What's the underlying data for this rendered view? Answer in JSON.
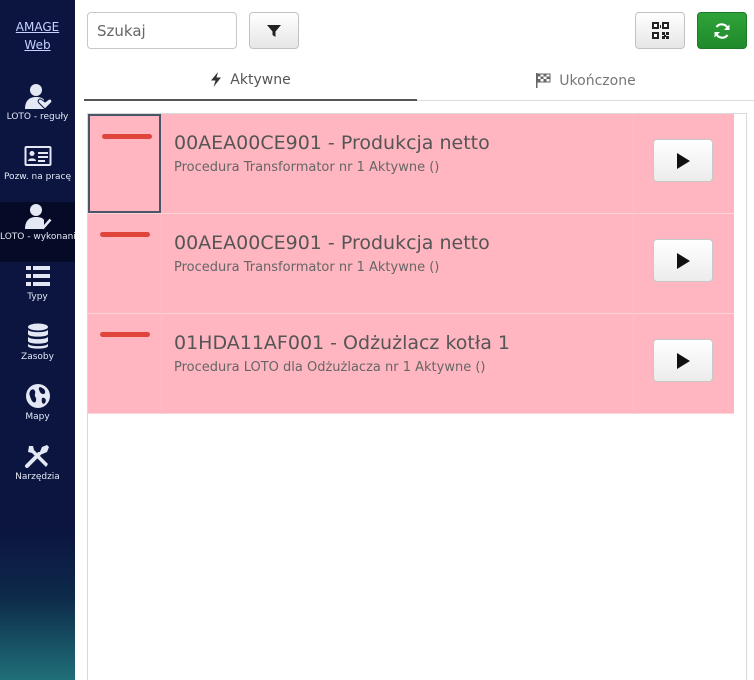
{
  "sidebar": {
    "brand": [
      "AMAGE",
      "Web"
    ],
    "items": [
      {
        "label": "LOTO - reguły",
        "icon": "user-heart-icon",
        "active": false
      },
      {
        "label": "Pozw. na pracę",
        "icon": "id-card-icon",
        "active": false
      },
      {
        "label": "LOTO - wykonanie",
        "icon": "user-check-icon",
        "active": true
      },
      {
        "label": "Typy",
        "icon": "list-icon",
        "active": false
      },
      {
        "label": "Zasoby",
        "icon": "database-icon",
        "active": false
      },
      {
        "label": "Mapy",
        "icon": "globe-icon",
        "active": false
      },
      {
        "label": "Narzędzia",
        "icon": "tools-icon",
        "active": false
      }
    ]
  },
  "toolbar": {
    "search_placeholder": "Szukaj",
    "filter_icon": "filter-icon",
    "qr_icon": "qr-code-icon",
    "refresh_icon": "refresh-icon"
  },
  "tabs": [
    {
      "label": "Aktywne",
      "icon": "bolt-icon",
      "active": true
    },
    {
      "label": "Ukończone",
      "icon": "checkered-flag-icon",
      "active": false
    }
  ],
  "rows": [
    {
      "title": "00AEA00CE901 - Produkcja netto",
      "subtitle": "Procedura Transformator nr 1 Aktywne ()"
    },
    {
      "title": "00AEA00CE901 - Produkcja netto",
      "subtitle": "Procedura Transformator nr 1 Aktywne ()"
    },
    {
      "title": "01HDA11AF001 - Odżużlacz kotła 1",
      "subtitle": "Procedura LOTO dla Odżużlacza nr 1 Aktywne ()"
    }
  ],
  "colors": {
    "sidebar_bg": "#0b1540",
    "row_bg": "#ffb6c1",
    "status_bar": "#e0453c",
    "refresh_button": "#2a9a35"
  }
}
